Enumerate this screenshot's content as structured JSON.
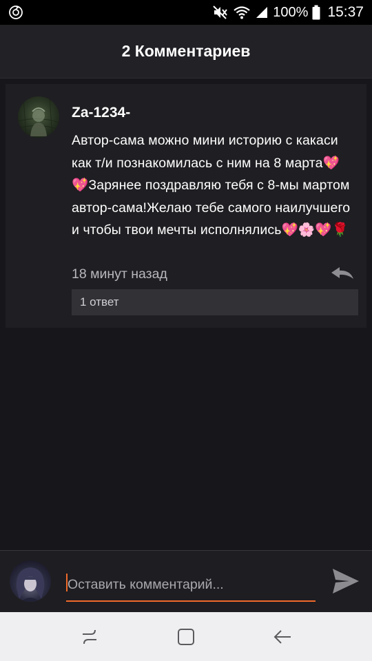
{
  "status_bar": {
    "battery_percent": "100%",
    "time": "15:37",
    "icons": [
      "sync-icon",
      "mute-icon",
      "wifi-icon",
      "signal-icon",
      "battery-icon"
    ]
  },
  "header": {
    "title": "2 Комментариев"
  },
  "comment": {
    "username": "Za-1234-",
    "text": "Автор-сама можно мини историю с какаси как т/и познакомилась с ним на 8 марта💖💖Зарянее поздравляю тебя с 8-мы мартом автор-сама!Желаю тебе самого наилучшего и чтобы твои мечты исполнялись💖🌸💖🌹",
    "time": "18 минут назад",
    "replies_label": "1 ответ"
  },
  "composer": {
    "placeholder": "Оставить комментарий...",
    "value": "",
    "accent_color": "#f06a2a"
  },
  "nav_bar": {
    "buttons": [
      "recents-icon",
      "home-icon",
      "back-icon"
    ]
  }
}
